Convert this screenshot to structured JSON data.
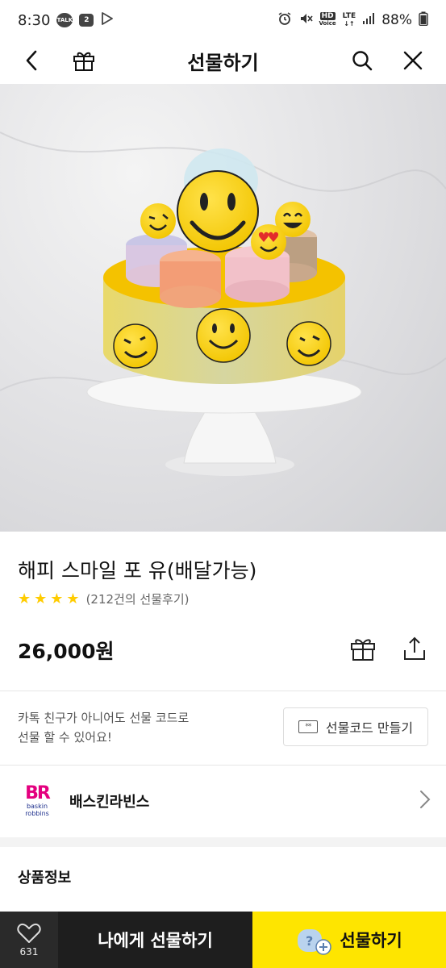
{
  "status_bar": {
    "time": "8:30",
    "battery": "88%",
    "notif_count": "2",
    "talk": "TALK",
    "hd": "HD",
    "volte": "Voice",
    "lte": "LTE"
  },
  "app_bar": {
    "title": "선물하기"
  },
  "product": {
    "name": "해피 스마일 포 유(배달가능)",
    "rating_stars": 4,
    "review_text": "(212건의 선물후기)",
    "price": "26,000원"
  },
  "gift_code": {
    "description_line1": "카톡 친구가 아니어도 선물 코드로",
    "description_line2": "선물 할 수 있어요!",
    "button_label": "선물코드 만들기",
    "ticket_glyph": "**"
  },
  "brand": {
    "name": "배스킨라빈스",
    "logo_letters": "BR",
    "logo_sub1": "baskin",
    "logo_sub2": "robbins"
  },
  "product_info": {
    "heading": "상품정보"
  },
  "bottom_bar": {
    "like_count": "631",
    "self_gift_label": "나에게 선물하기",
    "gift_label": "선물하기"
  },
  "colors": {
    "kakao_yellow": "#fee500",
    "dark": "#1e1e1e",
    "star": "#ffcc00",
    "brand_pink": "#e4007f",
    "brand_blue": "#1c2e8c"
  }
}
